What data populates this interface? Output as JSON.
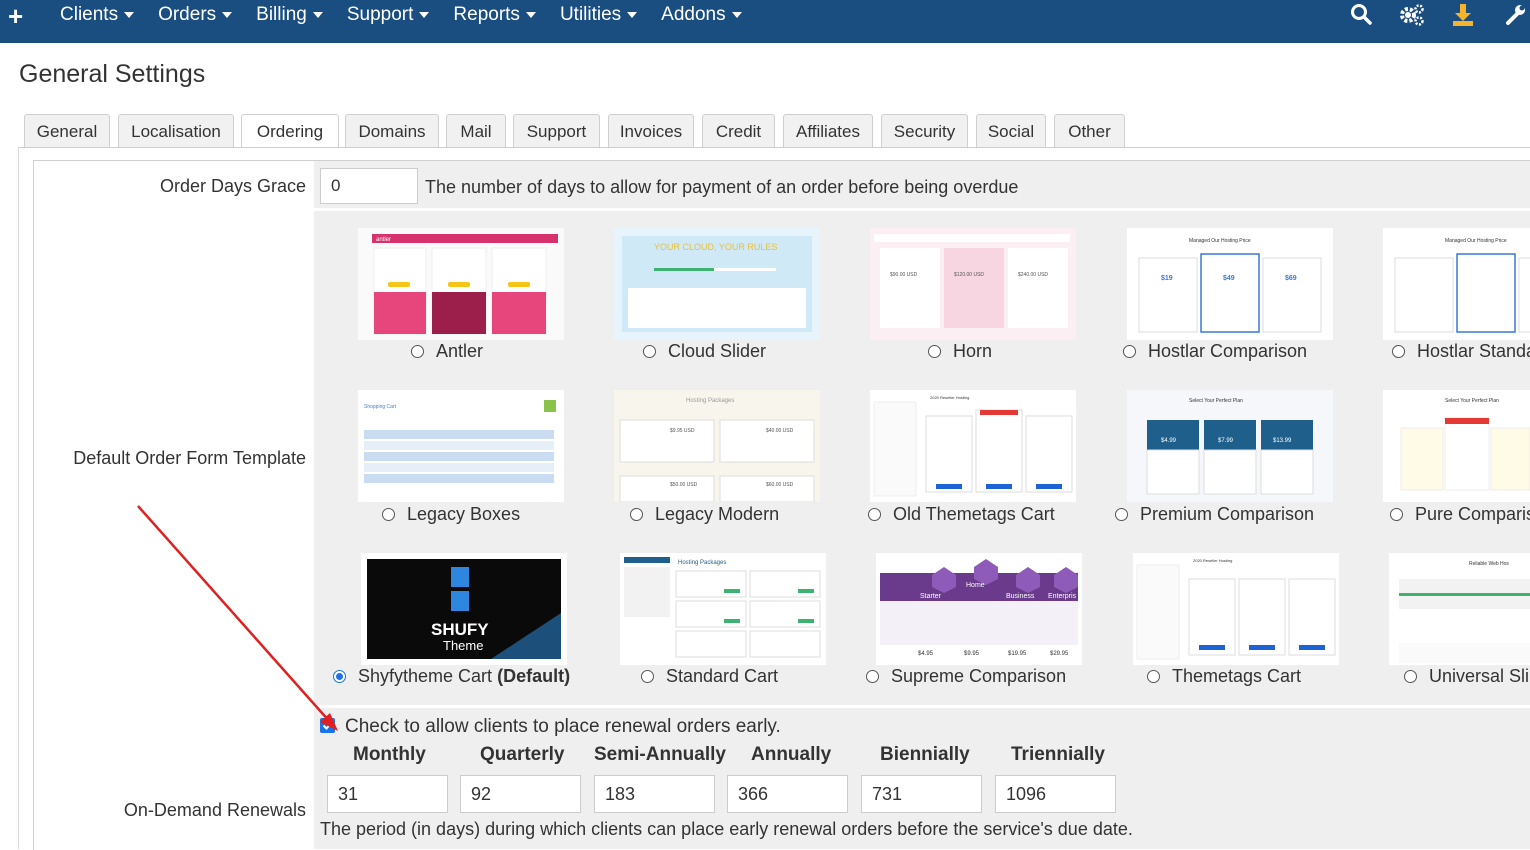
{
  "nav": {
    "items": [
      {
        "label": "Clients"
      },
      {
        "label": "Orders"
      },
      {
        "label": "Billing"
      },
      {
        "label": "Support"
      },
      {
        "label": "Reports"
      },
      {
        "label": "Utilities"
      },
      {
        "label": "Addons"
      }
    ],
    "icons": [
      "plus-icon",
      "search-icon",
      "gears-icon",
      "download-icon",
      "wrench-icon"
    ],
    "bg_color": "#1a4d80"
  },
  "page": {
    "title": "General Settings"
  },
  "tabs": [
    {
      "label": "General"
    },
    {
      "label": "Localisation"
    },
    {
      "label": "Ordering",
      "active": true
    },
    {
      "label": "Domains"
    },
    {
      "label": "Mail"
    },
    {
      "label": "Support"
    },
    {
      "label": "Invoices"
    },
    {
      "label": "Credit"
    },
    {
      "label": "Affiliates"
    },
    {
      "label": "Security"
    },
    {
      "label": "Social"
    },
    {
      "label": "Other"
    }
  ],
  "settings": {
    "order_days_grace": {
      "label": "Order Days Grace",
      "value": "0",
      "help": "The number of days to allow for payment of an order before being overdue"
    },
    "order_form": {
      "label": "Default Order Form Template",
      "templates": [
        {
          "name": "Antler"
        },
        {
          "name": "Cloud Slider"
        },
        {
          "name": "Horn"
        },
        {
          "name": "Hostlar Comparison"
        },
        {
          "name": "Hostlar Standa"
        },
        {
          "name": "Legacy Boxes"
        },
        {
          "name": "Legacy Modern"
        },
        {
          "name": "Old Themetags Cart"
        },
        {
          "name": "Premium Comparison"
        },
        {
          "name": "Pure Comparis"
        },
        {
          "name": "Shyfytheme Cart",
          "suffix": "(Default)",
          "selected": true
        },
        {
          "name": "Standard Cart"
        },
        {
          "name": "Supreme Comparison"
        },
        {
          "name": "Themetags Cart"
        },
        {
          "name": "Universal Sli"
        }
      ],
      "thumb_text": {
        "antler": "antler",
        "cloud": "YOUR CLOUD, YOUR RULES",
        "legacy_modern": "Hosting Packages",
        "shufy_logo": "SHUFY",
        "shufy_sub": "Theme",
        "supreme_cols": [
          "Starter",
          "Home",
          "Business",
          "Enterpris"
        ],
        "supreme_prices": [
          "$4.95",
          "$9.95",
          "$19.95",
          "$29.95"
        ],
        "std_title": "Hosting Packages",
        "premium_title": "Select Your Perfect Plan",
        "premium_prices": [
          "$4.99",
          "$7.99",
          "$13.99"
        ],
        "hostlar_title": "Managed Our Hosting Price",
        "hostlar_prices": [
          "$19",
          "$49",
          "$69"
        ],
        "legacy_boxes_title": "Shopping Cart",
        "legacy_modern_prices": [
          "$9.95 USD",
          "$40.00 USD",
          "$50.00 USD",
          "$60.00 USD"
        ],
        "horn_prices": [
          "$90.00 USD",
          "$120.00 USD",
          "$240.00 USD"
        ],
        "themetags_title": "2020 Reseller Hosting",
        "universal_title": "Reliable Web Hos"
      }
    },
    "renewals": {
      "label": "On-Demand Renewals",
      "checkbox_label": "Check to allow clients to place renewal orders early.",
      "checked": true,
      "periods": [
        {
          "name": "Monthly",
          "value": "31"
        },
        {
          "name": "Quarterly",
          "value": "92"
        },
        {
          "name": "Semi-Annually",
          "value": "183"
        },
        {
          "name": "Annually",
          "value": "366"
        },
        {
          "name": "Biennially",
          "value": "731"
        },
        {
          "name": "Triennially",
          "value": "1096"
        }
      ],
      "help": "The period (in days) during which clients can place early renewal orders before the service's due date."
    }
  },
  "colors": {
    "accent": "#1a73e8",
    "annotation_arrow": "#e02020"
  }
}
